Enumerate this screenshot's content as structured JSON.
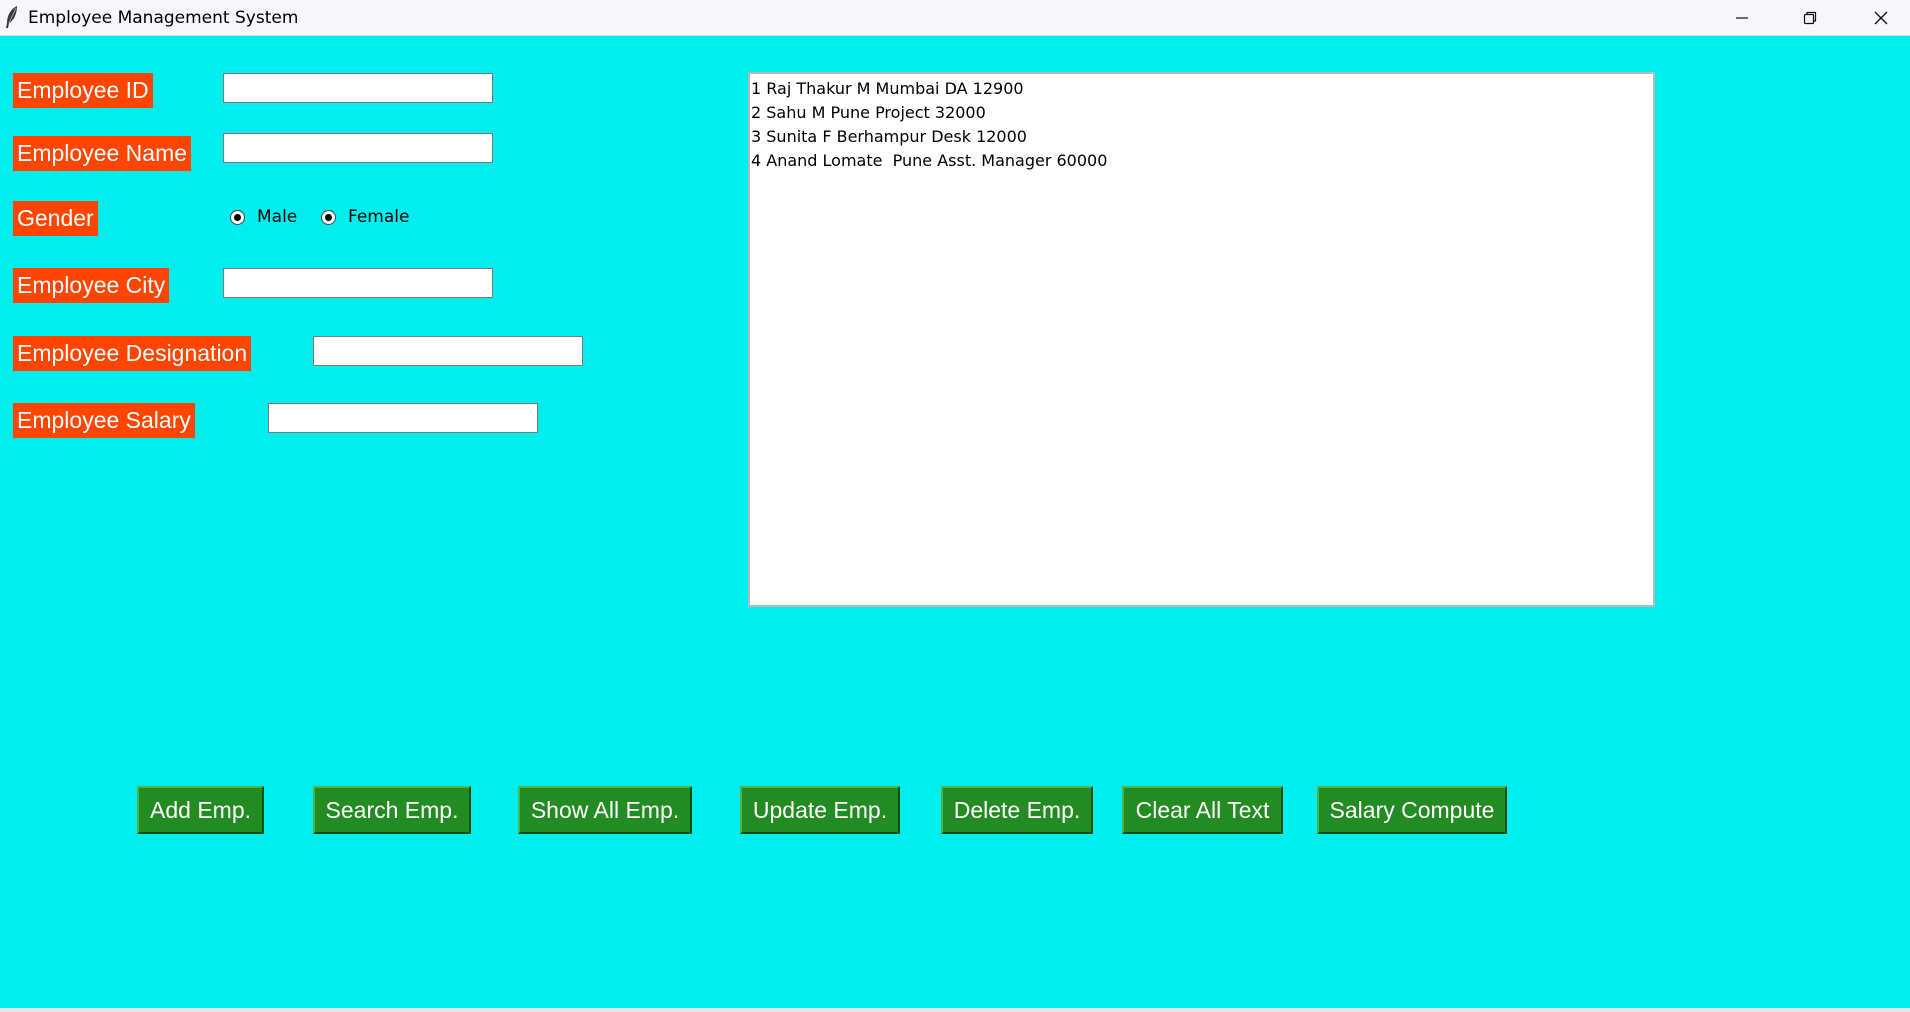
{
  "window": {
    "title": "Employee Management System",
    "icon": "feather-icon",
    "controls": [
      "minimize-icon",
      "restore-icon",
      "close-icon"
    ]
  },
  "colors": {
    "background": "#00EEEE",
    "label_bg": "#FF4500",
    "button_bg": "#228B22",
    "label_text": "#FFFFFF"
  },
  "form": {
    "employee_id": {
      "label": "Employee ID",
      "value": ""
    },
    "employee_name": {
      "label": "Employee Name",
      "value": ""
    },
    "gender": {
      "label": "Gender",
      "options": [
        "Male",
        "Female"
      ]
    },
    "employee_city": {
      "label": "Employee City",
      "value": ""
    },
    "employee_designation": {
      "label": "Employee Designation",
      "value": ""
    },
    "employee_salary": {
      "label": "Employee Salary",
      "value": ""
    }
  },
  "records": [
    "1 Raj Thakur M Mumbai DA 12900",
    "2 Sahu M Pune Project 32000",
    "3 Sunita F Berhampur Desk 12000",
    "4 Anand Lomate  Pune Asst. Manager 60000"
  ],
  "buttons": {
    "add": "Add Emp.",
    "search": "Search Emp.",
    "show_all": "Show All Emp.",
    "update": "Update Emp.",
    "delete": "Delete Emp.",
    "clear": "Clear All Text",
    "salary": "Salary Compute"
  }
}
